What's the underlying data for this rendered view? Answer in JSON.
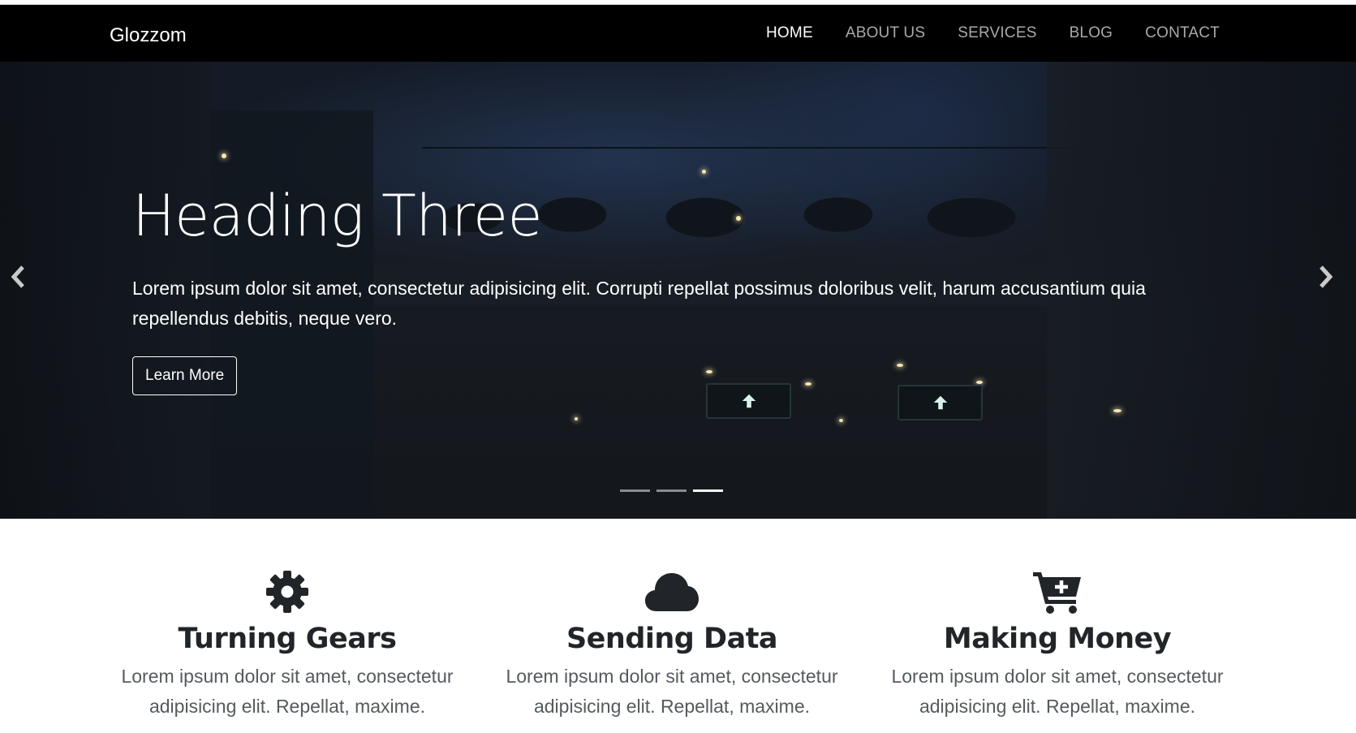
{
  "navbar": {
    "brand": "Glozzom",
    "links": [
      {
        "label": "HOME",
        "active": true
      },
      {
        "label": "ABOUT US",
        "active": false
      },
      {
        "label": "SERVICES",
        "active": false
      },
      {
        "label": "BLOG",
        "active": false
      },
      {
        "label": "CONTACT",
        "active": false
      }
    ]
  },
  "hero": {
    "heading": "Heading Three",
    "text": "Lorem ipsum dolor sit amet, consectetur adipisicing elit. Corrupti repellat possimus doloribus velit, harum accusantium quia repellendus debitis, neque vero.",
    "button_label": "Learn More",
    "prev_icon": "chevron-left-icon",
    "next_icon": "chevron-right-icon",
    "slide_count": 3,
    "active_slide": 3
  },
  "features": [
    {
      "icon": "gear-icon",
      "title": "Turning Gears",
      "text": "Lorem ipsum dolor sit amet, consectetur adipisicing elit. Repellat, maxime."
    },
    {
      "icon": "cloud-icon",
      "title": "Sending Data",
      "text": "Lorem ipsum dolor sit amet, consectetur adipisicing elit. Repellat, maxime."
    },
    {
      "icon": "cart-plus-icon",
      "title": "Making Money",
      "text": "Lorem ipsum dolor sit amet, consectetur adipisicing elit. Repellat, maxime."
    }
  ],
  "colors": {
    "navbar_bg": "#000000",
    "nav_link": "#a9a9a9",
    "nav_link_active": "#ffffff",
    "feature_text": "#212529"
  }
}
